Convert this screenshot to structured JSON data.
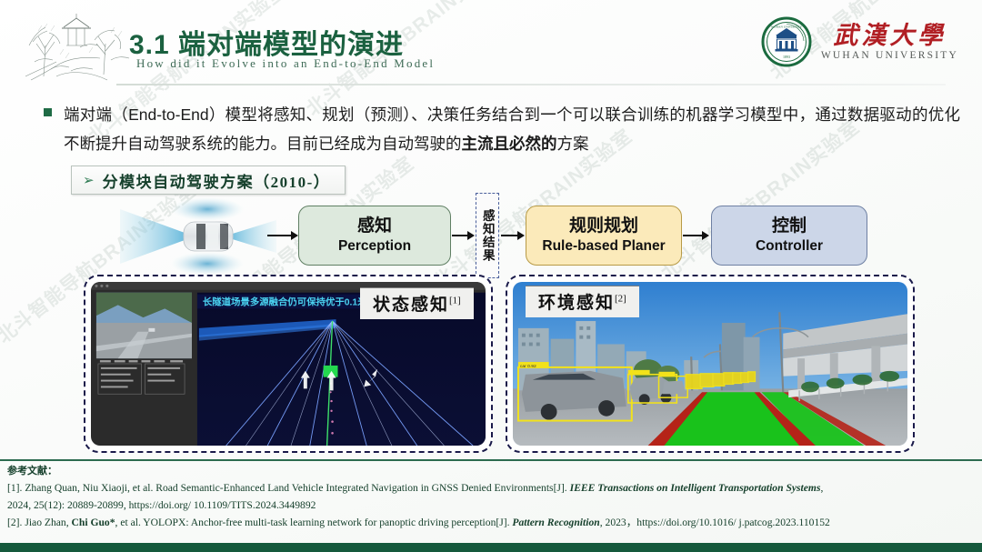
{
  "header": {
    "title_cn": "3.1 端对端模型的演进",
    "title_en": "How did it Evolve into an End-to-End Model",
    "logo_cn": "武漢大學",
    "logo_en": "WUHAN UNIVERSITY",
    "logo_seal_text": "WUHAN UNIVERSITY",
    "accent_color": "#1b6140",
    "logo_red": "#b11f24"
  },
  "body": {
    "bullet_text_1": "端对端（End-to-End）模型将感知、规划（预测）、决策任务结合到一个可以联合训练的机器学习模型中，通过数据驱动的优化不断提升自动驾驶系统的能力。目前已经成为自动驾驶的",
    "bullet_bold": "主流且必然的",
    "bullet_text_2": "方案",
    "section_arrow": "➢",
    "section_label": "分模块自动驾驶方案（2010-）"
  },
  "flow": {
    "boxes": [
      {
        "cn": "感知",
        "en": "Perception",
        "color": "#dde9dd"
      },
      {
        "cn": "规则规划",
        "en": "Rule-based Planer",
        "color": "#fbeaba"
      },
      {
        "cn": "控制",
        "en": "Controller",
        "color": "#ccd6e8"
      }
    ],
    "middle_label": "感知结果"
  },
  "panels": {
    "left": {
      "tag": "状态感知",
      "ref": "[1]"
    },
    "right": {
      "tag": "环境感知",
      "ref": "[2]"
    }
  },
  "references": {
    "heading": "参考文献：",
    "items": [
      {
        "prefix": "[1]. Zhang Quan, Niu Xiaoji, et al. Road Semantic-Enhanced Land Vehicle Integrated Navigation in GNSS Denied Environments[J]. ",
        "journal": "IEEE Transactions on Intelligent Transportation Systems",
        "suffix": ",",
        "line2": "2024, 25(12): 20889-20899, https://doi.org/ 10.1109/TITS.2024.3449892"
      },
      {
        "prefix": "[2]. Jiao Zhan, ",
        "bold": "Chi Guo*",
        "middle": ", et al. YOLOPX: Anchor-free multi-task learning network for panoptic driving perception[J].  ",
        "journal": "Pattern Recognition",
        "suffix": ", 2023，https://doi.org/10.1016/ j.patcog.2023.110152"
      }
    ]
  },
  "watermark": {
    "text": "北斗智能导航BRAIN实验室"
  }
}
